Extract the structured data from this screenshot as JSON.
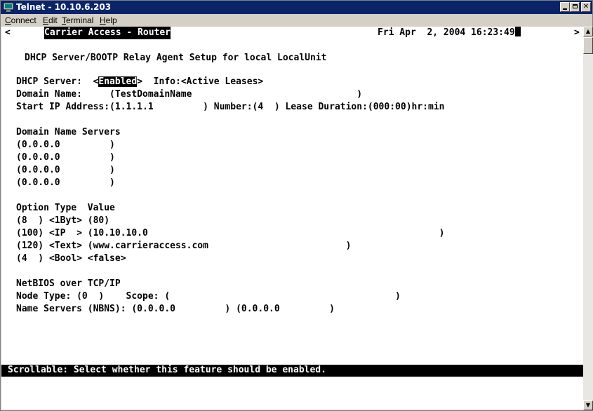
{
  "window": {
    "title": "Telnet - 10.10.6.203"
  },
  "menu": [
    {
      "label": "Connect",
      "underline": "C"
    },
    {
      "label": "Edit",
      "underline": "E"
    },
    {
      "label": "Terminal",
      "underline": "T"
    },
    {
      "label": "Help",
      "underline": "H"
    }
  ],
  "terminal": {
    "nav_left": "<",
    "system_title": "Carrier Access - Router",
    "datetime": "Fri Apr  2, 2004 16:23:49",
    "nav_right": ">",
    "heading": "DHCP Server/BOOTP Relay Agent Setup for local LocalUnit",
    "dhcp_server_label": "DHCP Server:  <",
    "dhcp_server_value": "Enabled",
    "dhcp_server_info": ">  Info:<Active Leases>",
    "domain_name_line": "Domain Name:     (TestDomainName                              )",
    "start_ip_line": "Start IP Address:(1.1.1.1         ) Number:(4  ) Lease Duration:(000:00)hr:min",
    "dns_header": "Domain Name Servers",
    "dns_servers": [
      "(0.0.0.0         )",
      "(0.0.0.0         )",
      "(0.0.0.0         )",
      "(0.0.0.0         )"
    ],
    "options_header": "Option Type  Value",
    "options": [
      "(8  ) <1Byt> (80)",
      "(100) <IP  > (10.10.10.0                                                     )",
      "(120) <Text> (www.carrieraccess.com                         )",
      "(4  ) <Bool> <false>"
    ],
    "netbios_header": "NetBIOS over TCP/IP",
    "node_type_line": "Node Type: (0  )    Scope: (                                         )",
    "nbns_line": "Name Servers (NBNS): (0.0.0.0         ) (0.0.0.0         )",
    "status_line": "Scrollable: Select whether this feature should be enabled."
  }
}
